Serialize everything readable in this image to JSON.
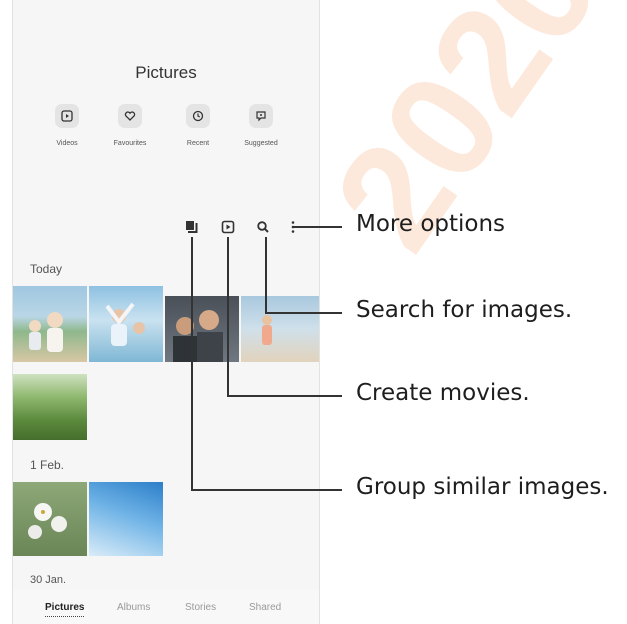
{
  "app": {
    "title": "Pictures"
  },
  "quick_access": [
    {
      "label": "Videos",
      "icon": "play-square-icon"
    },
    {
      "label": "Favourites",
      "icon": "heart-icon"
    },
    {
      "label": "Recent",
      "icon": "clock-icon"
    },
    {
      "label": "Suggested",
      "icon": "suggest-icon"
    }
  ],
  "toolbar": {
    "group_icon": "group-similar-icon",
    "movie_icon": "create-movie-icon",
    "search_icon": "search-icon",
    "more_icon": "more-options-icon"
  },
  "sections": [
    {
      "label": "Today"
    },
    {
      "label": "1 Feb."
    },
    {
      "label": "30 Jan."
    }
  ],
  "bottom_nav": [
    {
      "label": "Pictures",
      "active": true
    },
    {
      "label": "Albums"
    },
    {
      "label": "Stories"
    },
    {
      "label": "Shared"
    }
  ],
  "callouts": {
    "more_options": "More options",
    "search": "Search for images.",
    "create_movies": "Create movies.",
    "group": "Group similar images."
  },
  "watermark": "2020"
}
